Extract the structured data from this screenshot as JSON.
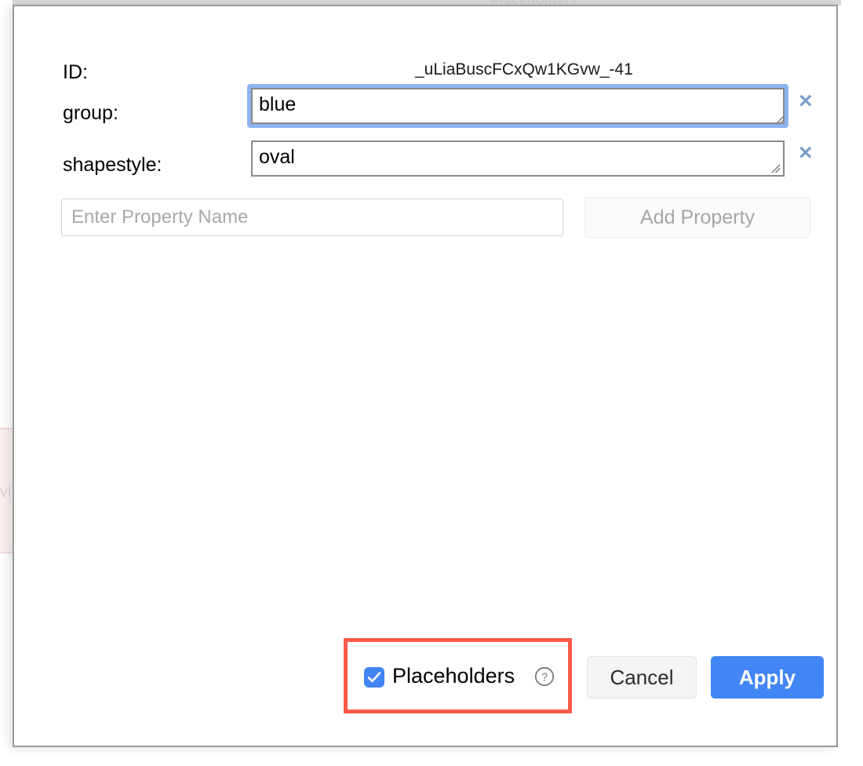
{
  "background": {
    "ghost_text_left": "vi",
    "ghost_text_top": "Placeholders"
  },
  "dialog": {
    "id_row": {
      "label": "ID:",
      "value": "_uLiaBuscFCxQw1KGvw_-41"
    },
    "properties": [
      {
        "label": "group:",
        "value": "blue",
        "focused": true,
        "delete_icon": "×"
      },
      {
        "label": "shapestyle:",
        "value": "oval",
        "focused": false,
        "delete_icon": "×"
      }
    ],
    "add_property_row": {
      "input_value": "",
      "input_placeholder": "Enter Property Name",
      "button_label": "Add Property"
    },
    "footer": {
      "placeholders_checkbox": {
        "label": "Placeholders",
        "checked": true
      },
      "help_icon": "help-circle-icon",
      "cancel_label": "Cancel",
      "apply_label": "Apply"
    }
  },
  "colors": {
    "accent_blue": "#4285f4",
    "focus_ring": "#8cb4f0",
    "annotation_red": "#fb5a4a",
    "delete_icon": "#7d9ecb",
    "border_gray": "#8a8a8a"
  }
}
